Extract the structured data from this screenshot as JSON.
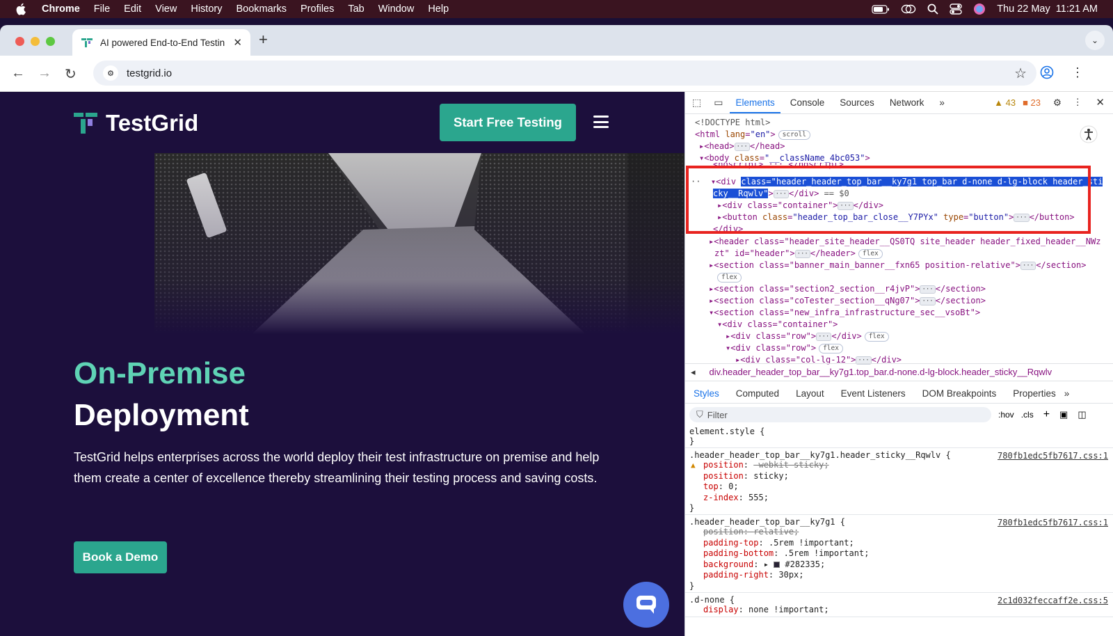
{
  "menubar": {
    "app": "Chrome",
    "items": [
      "File",
      "Edit",
      "View",
      "History",
      "Bookmarks",
      "Profiles",
      "Tab",
      "Window",
      "Help"
    ],
    "clock": "Thu 22 May  11:21 AM"
  },
  "browser": {
    "tab_title": "AI powered End-to-End Testin",
    "url": "testgrid.io"
  },
  "site": {
    "brand": "TestGrid",
    "cta_label": "Start Free Testing",
    "hero_title_1": "On-Premise",
    "hero_title_2": "Deployment",
    "hero_text": "TestGrid helps enterprises across the world deploy their test infrastructure on premise and help them create a center of excellence thereby streamlining their testing process and saving costs.",
    "demo_label": "Book a Demo",
    "accent": "#2ba68e",
    "title_color": "#5fd3b5"
  },
  "devtools": {
    "tabs": [
      "Elements",
      "Console",
      "Sources",
      "Network"
    ],
    "warnings": "43",
    "errors": "23",
    "breadcrumb": "div.header_header_top_bar__ky7g1.top_bar.d-none.d-lg-block.header_sticky__Rqwlv",
    "style_tabs": [
      "Styles",
      "Computed",
      "Layout",
      "Event Listeners",
      "DOM Breakpoints",
      "Properties"
    ],
    "filter_placeholder": "Filter",
    "hov": ":hov",
    "cls": ".cls",
    "dom": {
      "doctype": "<!DOCTYPE html>",
      "html_open": "<html ",
      "html_attr": "lang",
      "html_val": "\"en\"",
      "html_close": ">",
      "scroll_badge": "scroll",
      "head": "<head>",
      "head_close": "</head>",
      "body_open": "<body ",
      "body_attr": "class",
      "body_val": "\"__className_4bc053\"",
      "body_close": ">",
      "noscript": "<noscript> ··· </noscript>",
      "div_open": "<div ",
      "div_class_a": "class=\"header_header_top_bar__ky7g1 top_bar d-none d-lg-block header_sti",
      "div_class_b": "cky__Rqwlv\"",
      "div_tail": "</div>",
      "eq_sel": "== $0",
      "container": "<div class=\"container\">",
      "button_open": "<button ",
      "button_attr": "class",
      "button_val": "\"header_top_bar_close__Y7PYx\"",
      "button_attr2": "type",
      "button_val2": "\"button\"",
      "button_close": "</button>",
      "div_end": "</div>",
      "header_a": "<header class=\"header_site_header__QS0TQ site_header header_fixed_header__NWz",
      "header_b": "zt\" id=\"header\">",
      "header_close": "</header>",
      "flex": "flex",
      "banner": "<section class=\"banner_main_banner__fxn65 position-relative\">",
      "section_close": "</section>",
      "section2": "<section class=\"section2_section__r4jvP\">",
      "cotester": "<section class=\"coTester_section__qNg07\">",
      "infra": "<section class=\"new_infra_infrastructure_sec__vsoBt\">",
      "inner_container": "<div class=\"container\">",
      "row1": "<div class=\"row\">",
      "row2": "<div class=\"row\">",
      "col": "<div class=\"col-lg-12\">"
    },
    "styles": {
      "element_style": "element.style {",
      "close_brace": "}",
      "r1_selector": ".header_header_top_bar__ky7g1.header_sticky__Rqwlv {",
      "r1_src": "780fb1edc5fb7617.css:1",
      "r1_p1n": "position",
      "r1_p1v": "-webkit-sticky;",
      "r1_p2n": "position",
      "r1_p2v": "sticky;",
      "r1_p3n": "top",
      "r1_p3v": "0;",
      "r1_p4n": "z-index",
      "r1_p4v": "555;",
      "r2_selector": ".header_header_top_bar__ky7g1 {",
      "r2_src": "780fb1edc5fb7617.css:1",
      "r2_p1n": "position",
      "r2_p1v": "relative;",
      "r2_p2n": "padding-top",
      "r2_p2v": ".5rem !important;",
      "r2_p3n": "padding-bottom",
      "r2_p3v": ".5rem !important;",
      "r2_p4n": "background",
      "r2_p4v": "#282335;",
      "r2_p5n": "padding-right",
      "r2_p5v": "30px;",
      "r3_selector": ".d-none {",
      "r3_src": "2c1d032feccaff2e.css:5",
      "r3_p1n": "display",
      "r3_p1v": "none !important;"
    }
  }
}
